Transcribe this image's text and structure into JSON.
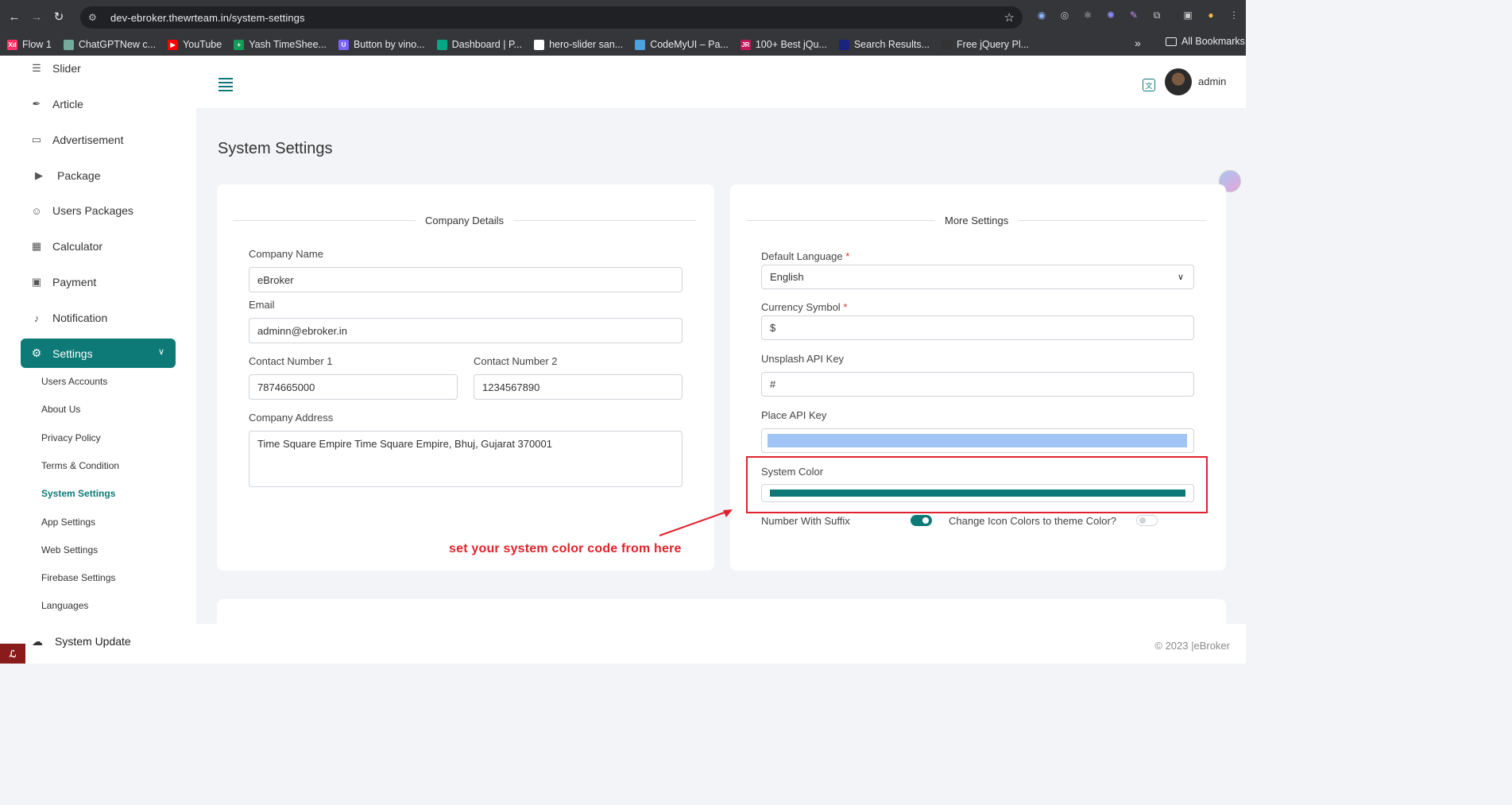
{
  "browser": {
    "url": "dev-ebroker.thewrteam.in/system-settings",
    "bookmarks": [
      {
        "label": "Flow 1",
        "color": "#ff3366",
        "glyph": "Xd"
      },
      {
        "label": "ChatGPTNew c...",
        "color": "#74aa9c",
        "glyph": ""
      },
      {
        "label": "YouTube",
        "color": "#ff0000",
        "glyph": "▶"
      },
      {
        "label": "Yash TimeShee...",
        "color": "#0f9d58",
        "glyph": "+"
      },
      {
        "label": "Button by vino...",
        "color": "#7b61ff",
        "glyph": "U"
      },
      {
        "label": "Dashboard | P...",
        "color": "#00a884",
        "glyph": ""
      },
      {
        "label": "hero-slider san...",
        "color": "#ffffff",
        "glyph": ""
      },
      {
        "label": "CodeMyUI – Pa...",
        "color": "#4aa3df",
        "glyph": ""
      },
      {
        "label": "100+ Best jQu...",
        "color": "#c2185b",
        "glyph": "JR"
      },
      {
        "label": "Search Results...",
        "color": "#1a237e",
        "glyph": ""
      },
      {
        "label": "Free jQuery Pl...",
        "color": "#333333",
        "glyph": ""
      }
    ],
    "all_bookmarks": "All Bookmarks",
    "overflow": "»"
  },
  "sidebar": {
    "items": [
      {
        "label": "Slider",
        "icon": "sliders-icon"
      },
      {
        "label": "Article",
        "icon": "pen-icon"
      },
      {
        "label": "Advertisement",
        "icon": "ad-icon"
      },
      {
        "label": "Package",
        "icon": "package-icon"
      },
      {
        "label": "Users Packages",
        "icon": "user-package-icon"
      },
      {
        "label": "Calculator",
        "icon": "calculator-icon"
      },
      {
        "label": "Payment",
        "icon": "payment-icon"
      },
      {
        "label": "Notification",
        "icon": "bell-icon"
      }
    ],
    "active": {
      "label": "Settings",
      "icon": "gear-icon"
    },
    "sub_items": [
      "Users Accounts",
      "About Us",
      "Privacy Policy",
      "Terms & Condition",
      "System Settings",
      "App Settings",
      "Web Settings",
      "Firebase Settings",
      "Languages"
    ],
    "active_sub": "System Settings",
    "system_update": "System Update"
  },
  "header": {
    "username": "admin"
  },
  "page": {
    "title": "System Settings"
  },
  "company": {
    "legend": "Company Details",
    "name_label": "Company Name",
    "name_value": "eBroker",
    "email_label": "Email",
    "email_value": "adminn@ebroker.in",
    "contact1_label": "Contact Number 1",
    "contact1_value": "7874665000",
    "contact2_label": "Contact Number 2",
    "contact2_value": "1234567890",
    "address_label": "Company Address",
    "address_value": "Time Square Empire Time Square Empire, Bhuj, Gujarat 370001"
  },
  "more": {
    "legend": "More Settings",
    "language_label": "Default Language",
    "language_value": "English",
    "currency_label": "Currency Symbol",
    "currency_value": "$",
    "unsplash_label": "Unsplash API Key",
    "unsplash_value": "#",
    "place_label": "Place API Key",
    "system_color_label": "System Color",
    "system_color": "#0d7a77",
    "suffix_label": "Number With Suffix",
    "suffix_on": true,
    "icon_color_label": "Change Icon Colors to theme Color?",
    "icon_color_on": false,
    "required_mark": "*"
  },
  "annotation": {
    "text": "set your system color code from here",
    "color": "#e0222c"
  },
  "footer": {
    "copyright": "© 2023 |eBroker"
  },
  "colors": {
    "accent": "#0d7a77"
  }
}
